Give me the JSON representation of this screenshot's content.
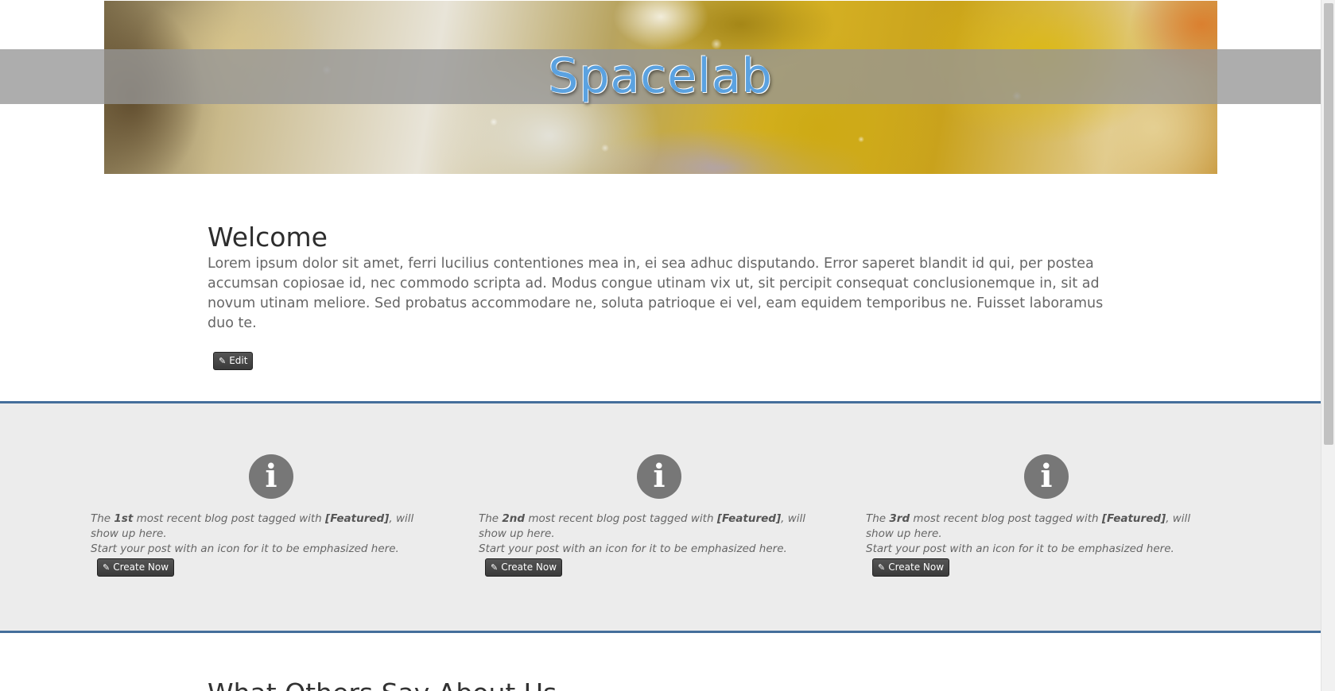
{
  "header": {
    "site_title": "Spacelab"
  },
  "welcome": {
    "heading": "Welcome",
    "body": "Lorem ipsum dolor sit amet, ferri lucilius contentiones mea in, ei sea adhuc disputando. Error saperet blandit id qui, per postea accumsan copiosae id, nec commodo scripta ad. Modus congue utinam vix ut, sit percipit consequat conclusionemque in, sit ad novum utinam meliore. Sed probatus accommodare ne, soluta patrioque ei vel, eam equidem temporibus ne. Fuisset laboramus duo te.",
    "edit_label": "Edit"
  },
  "featured": {
    "items": [
      {
        "prefix": "The ",
        "ordinal": "1st",
        "middle": " most recent blog post tagged with ",
        "tag": "[Featured]",
        "suffix": ", will show up here.",
        "line2": "Start your post with an icon for it to be emphasized here.",
        "button_label": "Create Now",
        "icon": "info-icon"
      },
      {
        "prefix": "The ",
        "ordinal": "2nd",
        "middle": " most recent blog post tagged with ",
        "tag": "[Featured]",
        "suffix": ", will show up here.",
        "line2": "Start your post with an icon for it to be emphasized here.",
        "button_label": "Create Now",
        "icon": "info-icon"
      },
      {
        "prefix": "The ",
        "ordinal": "3rd",
        "middle": " most recent blog post tagged with ",
        "tag": "[Featured]",
        "suffix": ", will show up here.",
        "line2": "Start your post with an icon for it to be emphasized here.",
        "button_label": "Create Now",
        "icon": "info-icon"
      }
    ]
  },
  "next_section": {
    "heading": "What Others Say About Us"
  },
  "colors": {
    "accent": "#446e9b",
    "title": "#5ba2e0",
    "band_bg": "#ececec"
  }
}
